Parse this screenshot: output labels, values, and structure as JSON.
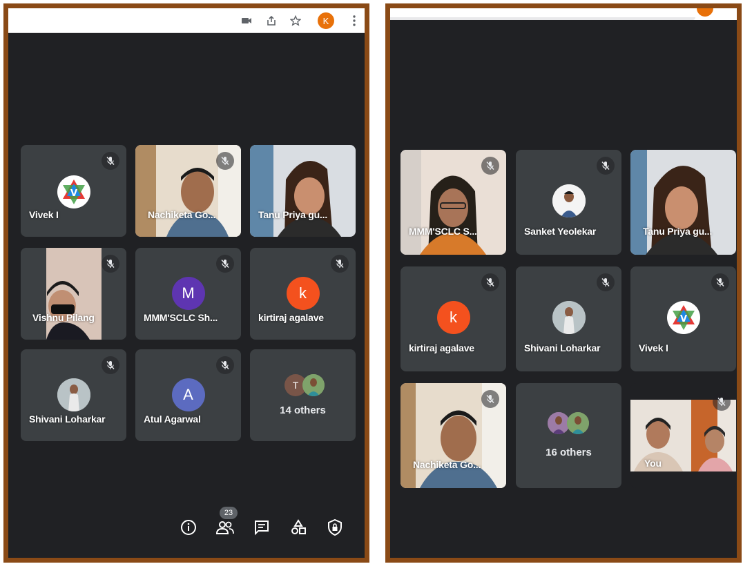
{
  "left": {
    "user_initial": "K",
    "tiles": [
      {
        "name": "Vivek I"
      },
      {
        "name": "Nachiketa Go..."
      },
      {
        "name": "Tanu Priya gu..."
      },
      {
        "name": "Vishnu Pilang"
      },
      {
        "name": "MMM'SCLC Sh...",
        "avatar_letter": "M"
      },
      {
        "name": "kirtiraj agalave",
        "avatar_letter": "k"
      },
      {
        "name": "Shivani Loharkar"
      },
      {
        "name": "Atul Agarwal",
        "avatar_letter": "A"
      },
      {
        "others_label": "14 others",
        "avatar_letter": "T"
      }
    ],
    "participant_count": "23",
    "controls": [
      "info-icon",
      "people-icon",
      "chat-icon",
      "activities-icon",
      "host-controls-icon"
    ]
  },
  "right": {
    "tiles": [
      {
        "name": "MMM'SCLC S..."
      },
      {
        "name": "Sanket Yeolekar"
      },
      {
        "name": "Tanu Priya gu..."
      },
      {
        "name": "kirtiraj agalave",
        "avatar_letter": "k"
      },
      {
        "name": "Shivani Loharkar"
      },
      {
        "name": "Vivek I"
      },
      {
        "name": "Nachiketa Go..."
      },
      {
        "others_label": "16 others"
      },
      {
        "name": "You"
      }
    ]
  },
  "colors": {
    "frame": "#8a4a16",
    "background": "#202124",
    "tile": "#3c4043",
    "avatar_orange": "#e8710a",
    "kirtiraj_avatar": "#f4511e",
    "m_avatar": "#5e35b1",
    "a_avatar": "#5c6bc0",
    "t_avatar": "#795548"
  }
}
